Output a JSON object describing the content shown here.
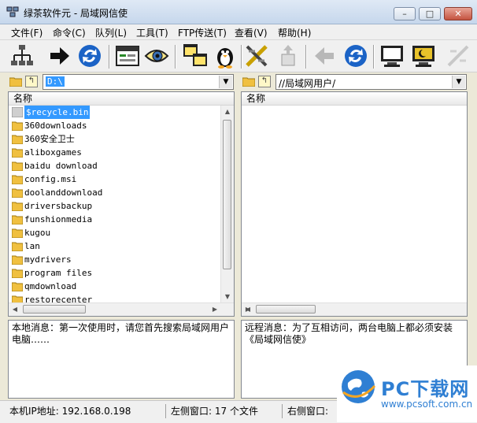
{
  "window": {
    "title": "绿茶软件元 - 局域网信使"
  },
  "menu": [
    "文件(F)",
    "命令(C)",
    "队列(L)",
    "工具(T)",
    "FTP传送(T)",
    "查看(V)",
    "帮助(H)"
  ],
  "toolbar": [
    "network-icon",
    "arrow-right-icon",
    "refresh-icon",
    "browser-window-icon",
    "eye-icon",
    "windows-copy-icon",
    "penguin-icon",
    "disconnect-icon",
    "upload-icon",
    "arrow-left-icon",
    "refresh-icon",
    "monitor-icon",
    "moon-screen-icon",
    "cut-icon"
  ],
  "left": {
    "path": "D:\\",
    "column_header": "名称",
    "files": [
      "$recycle.bin",
      "360downloads",
      "360安全卫士",
      "aliboxgames",
      "baidu download",
      "config.msi",
      "doolanddownload",
      "driversbackup",
      "funshionmedia",
      "kugou",
      "lan",
      "mydrivers",
      "program files",
      "qmdownload",
      "restorecenter"
    ],
    "selected_index": 0,
    "message": "本地消息：第一次使用时，请您首先搜索局域网用户电脑……"
  },
  "right": {
    "path": "//局域网用户/",
    "column_header": "名称",
    "message": "远程消息：为了互相访问，两台电脑上都必须安装《局域网信使》"
  },
  "status": {
    "ip": "本机IP地址: 192.168.0.198",
    "left_window": "左侧窗口: 17 个文件",
    "right_window": "右侧窗口:"
  },
  "watermark": {
    "title": "PC下载网",
    "url": "www.pcsoft.com.cn"
  },
  "colors": {
    "selection": "#3399ff",
    "folder": "#f0c040",
    "watermark": "#2f7fd3"
  }
}
